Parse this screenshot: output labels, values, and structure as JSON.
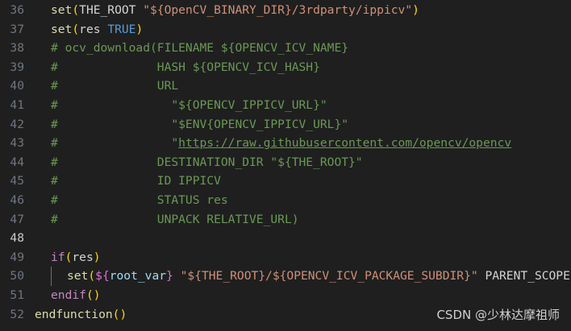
{
  "editor": {
    "active_line": "48",
    "watermark": "CSDN @少林达摩祖师",
    "lines": [
      {
        "num": "36",
        "indent": 1,
        "tokens": [
          {
            "t": "set",
            "c": "k-func"
          },
          {
            "t": "(",
            "c": "k-paren"
          },
          {
            "t": "THE_ROOT ",
            "c": "k-text"
          },
          {
            "t": "\"${OpenCV_BINARY_DIR}/3rdparty/ippicv\"",
            "c": "k-str"
          },
          {
            "t": ")",
            "c": "k-paren"
          }
        ]
      },
      {
        "num": "37",
        "indent": 1,
        "tokens": [
          {
            "t": "set",
            "c": "k-func"
          },
          {
            "t": "(",
            "c": "k-paren"
          },
          {
            "t": "res ",
            "c": "k-text"
          },
          {
            "t": "TRUE",
            "c": "k-const"
          },
          {
            "t": ")",
            "c": "k-paren"
          }
        ]
      },
      {
        "num": "38",
        "indent": 1,
        "tokens": [
          {
            "t": "# ocv_download(FILENAME ${OPENCV_ICV_NAME}",
            "c": "k-cmt"
          }
        ]
      },
      {
        "num": "39",
        "indent": 1,
        "tokens": [
          {
            "t": "#              HASH ${OPENCV_ICV_HASH}",
            "c": "k-cmt"
          }
        ]
      },
      {
        "num": "40",
        "indent": 1,
        "tokens": [
          {
            "t": "#              URL",
            "c": "k-cmt"
          }
        ]
      },
      {
        "num": "41",
        "indent": 1,
        "tokens": [
          {
            "t": "#                \"${OPENCV_IPPICV_URL}\"",
            "c": "k-cmt"
          }
        ]
      },
      {
        "num": "42",
        "indent": 1,
        "tokens": [
          {
            "t": "#                \"$ENV{OPENCV_IPPICV_URL}\"",
            "c": "k-cmt"
          }
        ]
      },
      {
        "num": "43",
        "indent": 1,
        "tokens": [
          {
            "t": "#                \"",
            "c": "k-cmt"
          },
          {
            "t": "https://raw.githubusercontent.com/opencv/opencv",
            "c": "k-link"
          }
        ]
      },
      {
        "num": "44",
        "indent": 1,
        "tokens": [
          {
            "t": "#              DESTINATION_DIR \"${THE_ROOT}\"",
            "c": "k-cmt"
          }
        ]
      },
      {
        "num": "45",
        "indent": 1,
        "tokens": [
          {
            "t": "#              ID IPPICV",
            "c": "k-cmt"
          }
        ]
      },
      {
        "num": "46",
        "indent": 1,
        "tokens": [
          {
            "t": "#              STATUS res",
            "c": "k-cmt"
          }
        ]
      },
      {
        "num": "47",
        "indent": 1,
        "tokens": [
          {
            "t": "#              UNPACK RELATIVE_URL)",
            "c": "k-cmt"
          }
        ]
      },
      {
        "num": "48",
        "indent": 1,
        "tokens": []
      },
      {
        "num": "49",
        "indent": 1,
        "tokens": [
          {
            "t": "if",
            "c": "k-ctrl"
          },
          {
            "t": "(",
            "c": "k-paren"
          },
          {
            "t": "res",
            "c": "k-text"
          },
          {
            "t": ")",
            "c": "k-paren"
          }
        ]
      },
      {
        "num": "50",
        "indent": 2,
        "tokens": [
          {
            "t": "set",
            "c": "k-func"
          },
          {
            "t": "(",
            "c": "k-paren"
          },
          {
            "t": "${",
            "c": "k-paren2"
          },
          {
            "t": "root_var",
            "c": "k-var"
          },
          {
            "t": "}",
            "c": "k-paren2"
          },
          {
            "t": " ",
            "c": "k-text"
          },
          {
            "t": "\"${THE_ROOT}/${OPENCV_ICV_PACKAGE_SUBDIR}\"",
            "c": "k-str"
          },
          {
            "t": " PARENT_SCOPE",
            "c": "k-text"
          }
        ]
      },
      {
        "num": "51",
        "indent": 1,
        "tokens": [
          {
            "t": "endif",
            "c": "k-ctrl"
          },
          {
            "t": "()",
            "c": "k-paren"
          }
        ]
      },
      {
        "num": "52",
        "indent": 0,
        "tokens": [
          {
            "t": "endfunction",
            "c": "k-func"
          },
          {
            "t": "()",
            "c": "k-paren"
          }
        ]
      }
    ]
  }
}
